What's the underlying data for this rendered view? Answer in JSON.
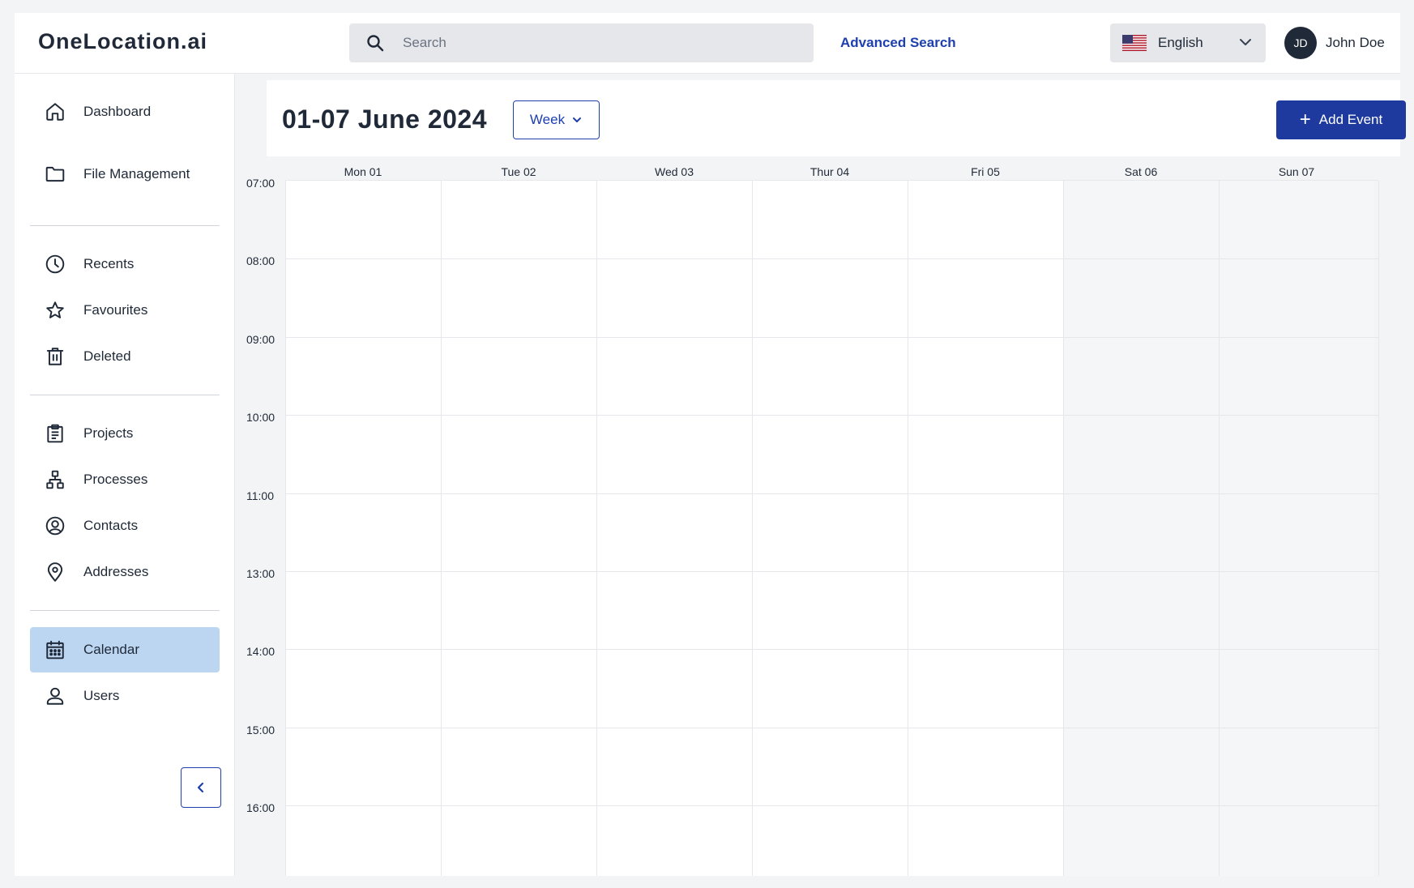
{
  "header": {
    "logo": "OneLocation.ai",
    "search_placeholder": "Search",
    "advanced_search": "Advanced Search",
    "language": "English",
    "user_initials": "JD",
    "user_name": "John Doe"
  },
  "sidebar": {
    "items": [
      {
        "label": "Dashboard",
        "icon": "home-icon"
      },
      {
        "label": "File Management",
        "icon": "folder-icon"
      },
      {
        "label": "Recents",
        "icon": "clock-icon"
      },
      {
        "label": "Favourites",
        "icon": "star-icon"
      },
      {
        "label": "Deleted",
        "icon": "trash-icon"
      },
      {
        "label": "Projects",
        "icon": "clipboard-icon"
      },
      {
        "label": "Processes",
        "icon": "hierarchy-icon"
      },
      {
        "label": "Contacts",
        "icon": "user-circle-icon"
      },
      {
        "label": "Addresses",
        "icon": "map-pin-icon"
      },
      {
        "label": "Calendar",
        "icon": "calendar-icon",
        "active": true
      },
      {
        "label": "Users",
        "icon": "user-icon"
      }
    ]
  },
  "toolbar": {
    "date_range": "01-07 June 2024",
    "view_label": "Week",
    "add_event_label": "Add Event"
  },
  "calendar": {
    "days": [
      "Mon 01",
      "Tue 02",
      "Wed 03",
      "Thur 04",
      "Fri 05",
      "Sat 06",
      "Sun 07"
    ],
    "weekend_days": [
      "Sat 06",
      "Sun 07"
    ],
    "times": [
      "07:00",
      "08:00",
      "09:00",
      "10:00",
      "11:00",
      "13:00",
      "14:00",
      "15:00",
      "16:00"
    ]
  },
  "colors": {
    "accent": "#1e40af",
    "active_nav": "#bcd6f1",
    "add_event_bg": "#1e3a9f"
  }
}
